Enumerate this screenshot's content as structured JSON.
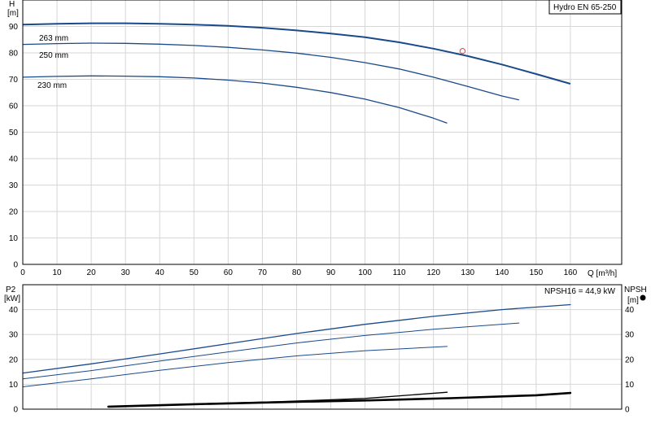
{
  "chart_data": [
    {
      "type": "line",
      "title": "Hydro EN 65-250",
      "ylabel_lines": [
        "H",
        "[m]"
      ],
      "xlabel": "Q [m³/h]",
      "xlim": [
        0,
        175
      ],
      "ylim": [
        0,
        100
      ],
      "xticks": [
        0,
        10,
        20,
        30,
        40,
        50,
        60,
        70,
        80,
        90,
        100,
        110,
        120,
        130,
        140,
        150,
        160
      ],
      "yticks": [
        0,
        10,
        20,
        30,
        40,
        50,
        60,
        70,
        80,
        90
      ],
      "grid": true,
      "series": [
        {
          "name": "263 mm",
          "color": "#1a4a8a",
          "x": [
            0,
            10,
            20,
            30,
            40,
            50,
            60,
            70,
            80,
            90,
            100,
            110,
            120,
            130,
            140,
            150,
            160
          ],
          "y": [
            90.7,
            91.0,
            91.2,
            91.2,
            91.0,
            90.7,
            90.2,
            89.5,
            88.5,
            87.3,
            85.9,
            84.0,
            81.6,
            78.8,
            75.6,
            72.0,
            68.3
          ]
        },
        {
          "name": "250 mm",
          "color": "#1a4a8a",
          "x": [
            0,
            10,
            20,
            30,
            40,
            50,
            60,
            70,
            80,
            90,
            100,
            110,
            120,
            130,
            140,
            145
          ],
          "y": [
            83.2,
            83.5,
            83.7,
            83.6,
            83.3,
            82.8,
            82.1,
            81.1,
            79.9,
            78.3,
            76.3,
            73.9,
            70.8,
            67.3,
            63.7,
            62.2
          ]
        },
        {
          "name": "230 mm",
          "color": "#1a4a8a",
          "x": [
            0,
            10,
            20,
            30,
            40,
            50,
            60,
            70,
            80,
            90,
            100,
            110,
            120,
            124
          ],
          "y": [
            70.8,
            71.1,
            71.3,
            71.2,
            71.0,
            70.5,
            69.7,
            68.6,
            67.0,
            65.0,
            62.5,
            59.3,
            55.3,
            53.4
          ]
        }
      ],
      "operating_point": {
        "x": 128.5,
        "y": 80.7,
        "color": "#e8433a"
      }
    },
    {
      "type": "line",
      "ylabel_lines": [
        "P2",
        "[kW]"
      ],
      "ylabel2_lines": [
        "NPSH",
        "[m]"
      ],
      "annotation": "NPSH16 = 44,9 kW",
      "xlim": [
        0,
        175
      ],
      "ylim": [
        0,
        50
      ],
      "yticks": [
        0,
        10,
        20,
        30,
        40
      ],
      "grid": true,
      "series": [
        {
          "name": "",
          "color": "#1a4a8a",
          "width": 1.3,
          "x": [
            0,
            20,
            40,
            60,
            80,
            100,
            120,
            140,
            160
          ],
          "y": [
            14.5,
            18.2,
            22.2,
            26.3,
            30.4,
            34.1,
            37.3,
            40.0,
            42.0
          ]
        },
        {
          "name": "",
          "color": "#1a4a8a",
          "width": 1.0,
          "x": [
            0,
            20,
            40,
            60,
            80,
            100,
            120,
            145
          ],
          "y": [
            12.2,
            15.5,
            19.3,
            23.0,
            26.6,
            29.6,
            32.1,
            34.6
          ]
        },
        {
          "name": "",
          "color": "#1a4a8a",
          "width": 1.0,
          "x": [
            0,
            20,
            40,
            60,
            80,
            100,
            124
          ],
          "y": [
            9.0,
            12.2,
            15.6,
            18.7,
            21.4,
            23.5,
            25.2
          ]
        },
        {
          "name": "",
          "color": "#000000",
          "width": 2.6,
          "x": [
            25,
            50,
            75,
            100,
            125,
            150,
            160
          ],
          "y": [
            1.0,
            2.0,
            2.8,
            3.5,
            4.4,
            5.6,
            6.5
          ]
        },
        {
          "name": "",
          "color": "#000000",
          "width": 1.3,
          "x": [
            25,
            50,
            75,
            100,
            124
          ],
          "y": [
            1.0,
            2.1,
            3.0,
            4.3,
            6.8
          ]
        }
      ]
    }
  ]
}
